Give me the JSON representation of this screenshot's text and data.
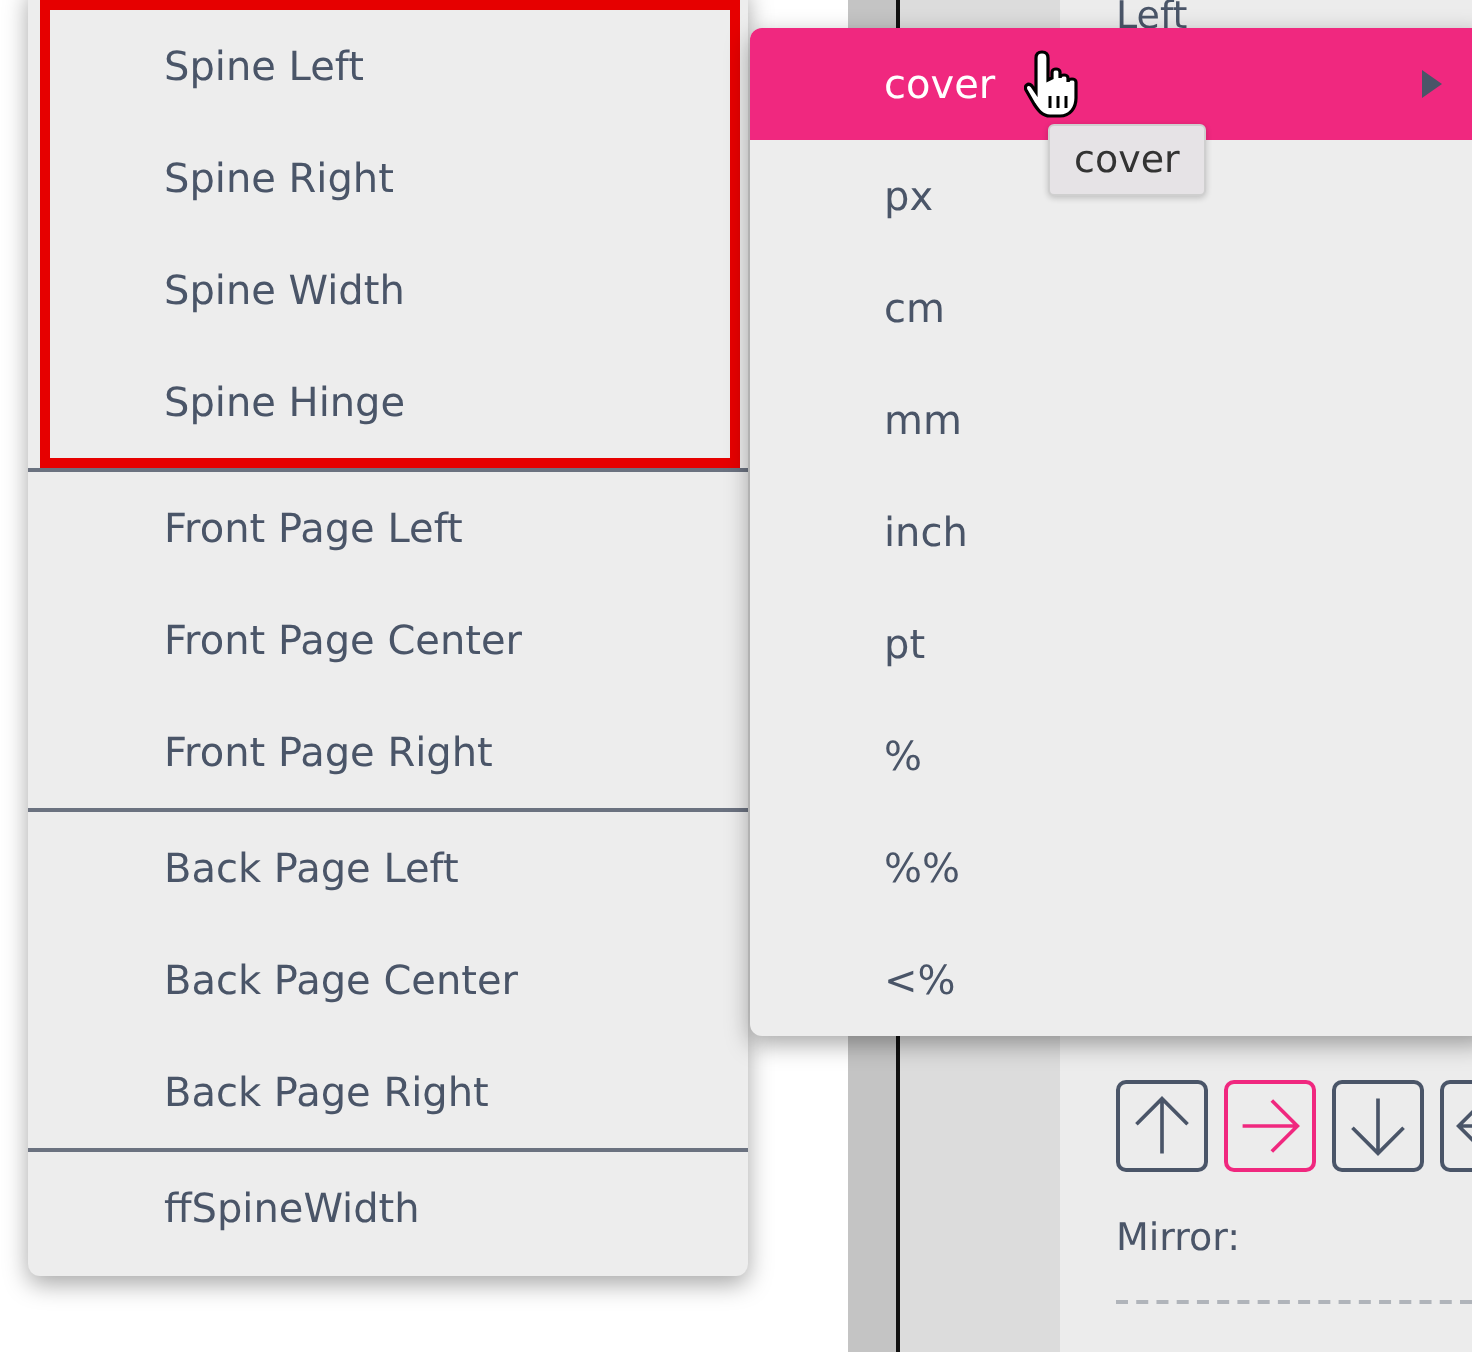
{
  "panel": {
    "top_label": "Left",
    "rotation_buttons": [
      {
        "kind": "up",
        "selected": false
      },
      {
        "kind": "right",
        "selected": true
      },
      {
        "kind": "down",
        "selected": false
      },
      {
        "kind": "left",
        "selected": false
      }
    ],
    "mirror_label": "Mirror:"
  },
  "menu": {
    "sections": [
      {
        "highlighted": true,
        "items": [
          "Spine Left",
          "Spine Right",
          "Spine Width",
          "Spine Hinge"
        ]
      },
      {
        "highlighted": false,
        "items": [
          "Front Page Left",
          "Front Page Center",
          "Front Page Right"
        ]
      },
      {
        "highlighted": false,
        "items": [
          "Back Page Left",
          "Back Page Center",
          "Back Page Right"
        ]
      },
      {
        "highlighted": false,
        "items": [
          "ffSpineWidth"
        ]
      }
    ]
  },
  "submenu": {
    "items": [
      {
        "label": "cover",
        "selected": true,
        "has_submenu": true
      },
      {
        "label": "px",
        "selected": false,
        "has_submenu": false
      },
      {
        "label": "cm",
        "selected": false,
        "has_submenu": false
      },
      {
        "label": "mm",
        "selected": false,
        "has_submenu": false
      },
      {
        "label": "inch",
        "selected": false,
        "has_submenu": false
      },
      {
        "label": "pt",
        "selected": false,
        "has_submenu": false
      },
      {
        "label": "%",
        "selected": false,
        "has_submenu": false
      },
      {
        "label": "%%",
        "selected": false,
        "has_submenu": false
      },
      {
        "label": "<%",
        "selected": false,
        "has_submenu": false
      }
    ]
  },
  "tooltip": "cover"
}
